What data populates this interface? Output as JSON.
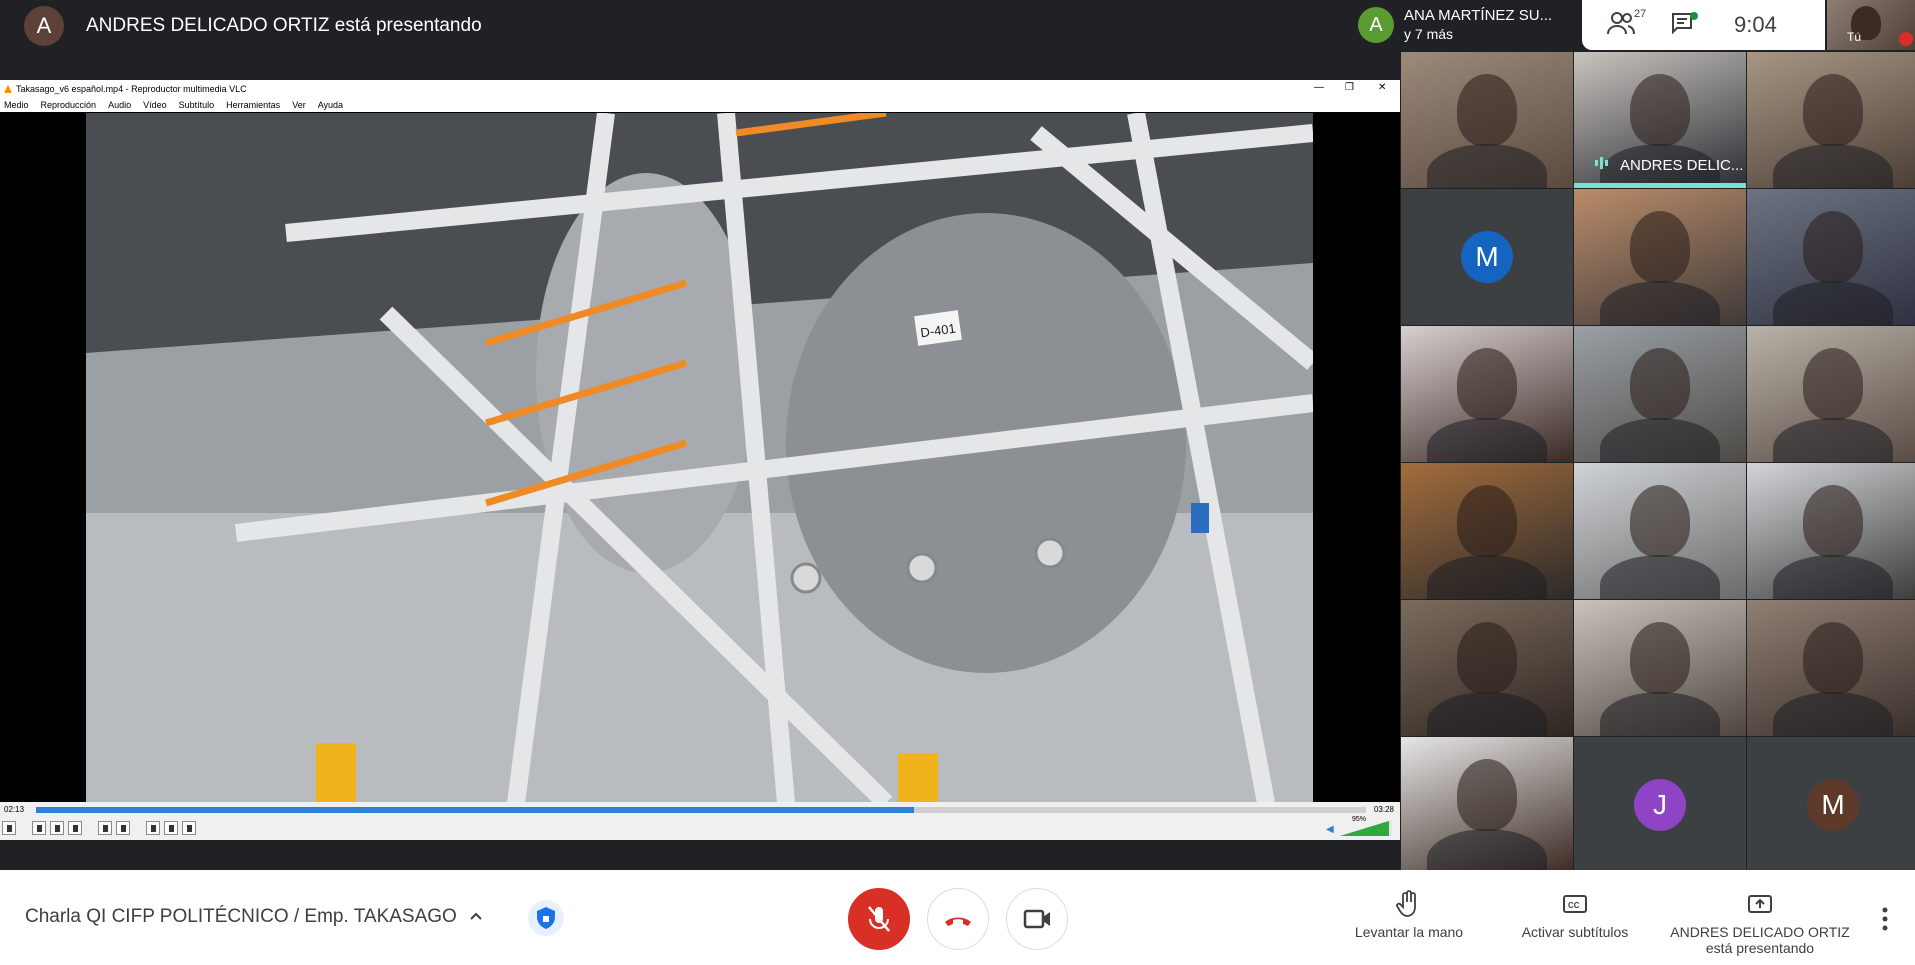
{
  "presenter": {
    "avatar_letter": "A",
    "text": "ANDRES DELICADO ORTIZ está presentando"
  },
  "top_chip": {
    "avatar_letter": "A",
    "name": "ANA MARTÍNEZ SU...",
    "more": "y 7 más"
  },
  "info_panel": {
    "people_count": "27",
    "time": "9:04"
  },
  "self_view": {
    "label": "Tú"
  },
  "vlc": {
    "title": "Takasago_v6 español.mp4 - Reproductor multimedia VLC",
    "menu": [
      "Medio",
      "Reproducción",
      "Audio",
      "Vídeo",
      "Subtítulo",
      "Herramientas",
      "Ver",
      "Ayuda"
    ],
    "time_elapsed": "02:13",
    "time_total": "03:28",
    "progress": 0.66,
    "volume_label": "95%",
    "volume": 0.95,
    "video_tag": "D-401"
  },
  "participants": [
    {
      "type": "video",
      "colors": [
        "#9c8a7a",
        "#5a4a3f"
      ]
    },
    {
      "type": "video",
      "name": "ANDRES DELIC...",
      "speaking": true,
      "colors": [
        "#c8c4bf",
        "#2b2d33"
      ]
    },
    {
      "type": "video",
      "colors": [
        "#a79683",
        "#4a3e36"
      ]
    },
    {
      "type": "avatar",
      "letter": "M",
      "color": "#1565c0"
    },
    {
      "type": "video",
      "colors": [
        "#b98c6a",
        "#3f3a38"
      ]
    },
    {
      "type": "video",
      "colors": [
        "#6d7381",
        "#2e3140"
      ]
    },
    {
      "type": "video",
      "colors": [
        "#d8cfcf",
        "#3a2a26"
      ]
    },
    {
      "type": "video",
      "colors": [
        "#9aa0a6",
        "#4d4a45"
      ]
    },
    {
      "type": "video",
      "colors": [
        "#b8b2a8",
        "#5a4c45"
      ]
    },
    {
      "type": "video",
      "colors": [
        "#a26d3c",
        "#2d2a2a"
      ]
    },
    {
      "type": "video",
      "colors": [
        "#cfd3d6",
        "#6b6a6a"
      ]
    },
    {
      "type": "video",
      "colors": [
        "#d2d5d8",
        "#3d3c3c"
      ]
    },
    {
      "type": "video",
      "colors": [
        "#7b6b5c",
        "#2f2622"
      ]
    },
    {
      "type": "video",
      "colors": [
        "#c9c3bb",
        "#4f4540"
      ]
    },
    {
      "type": "video",
      "colors": [
        "#8f7f73",
        "#3a302c"
      ]
    },
    {
      "type": "video",
      "colors": [
        "#e6e6e6",
        "#3b2a22"
      ]
    },
    {
      "type": "avatar",
      "letter": "J",
      "color": "#8e44c4"
    },
    {
      "type": "avatar",
      "letter": "M",
      "color": "#5d3a2a"
    }
  ],
  "bottom_bar": {
    "meeting_title": "Charla QI CIFP POLITÉCNICO / Emp. TAKASAGO",
    "raise_hand": "Levantar la mano",
    "captions": "Activar subtítulos",
    "presenting_line1": "ANDRES DELICADO ORTIZ",
    "presenting_line2": "está presentando"
  },
  "colors": {
    "mic_off": "#d93025",
    "speaking": "#7ce0d3",
    "vlc_progress": "#2f7fd6"
  }
}
